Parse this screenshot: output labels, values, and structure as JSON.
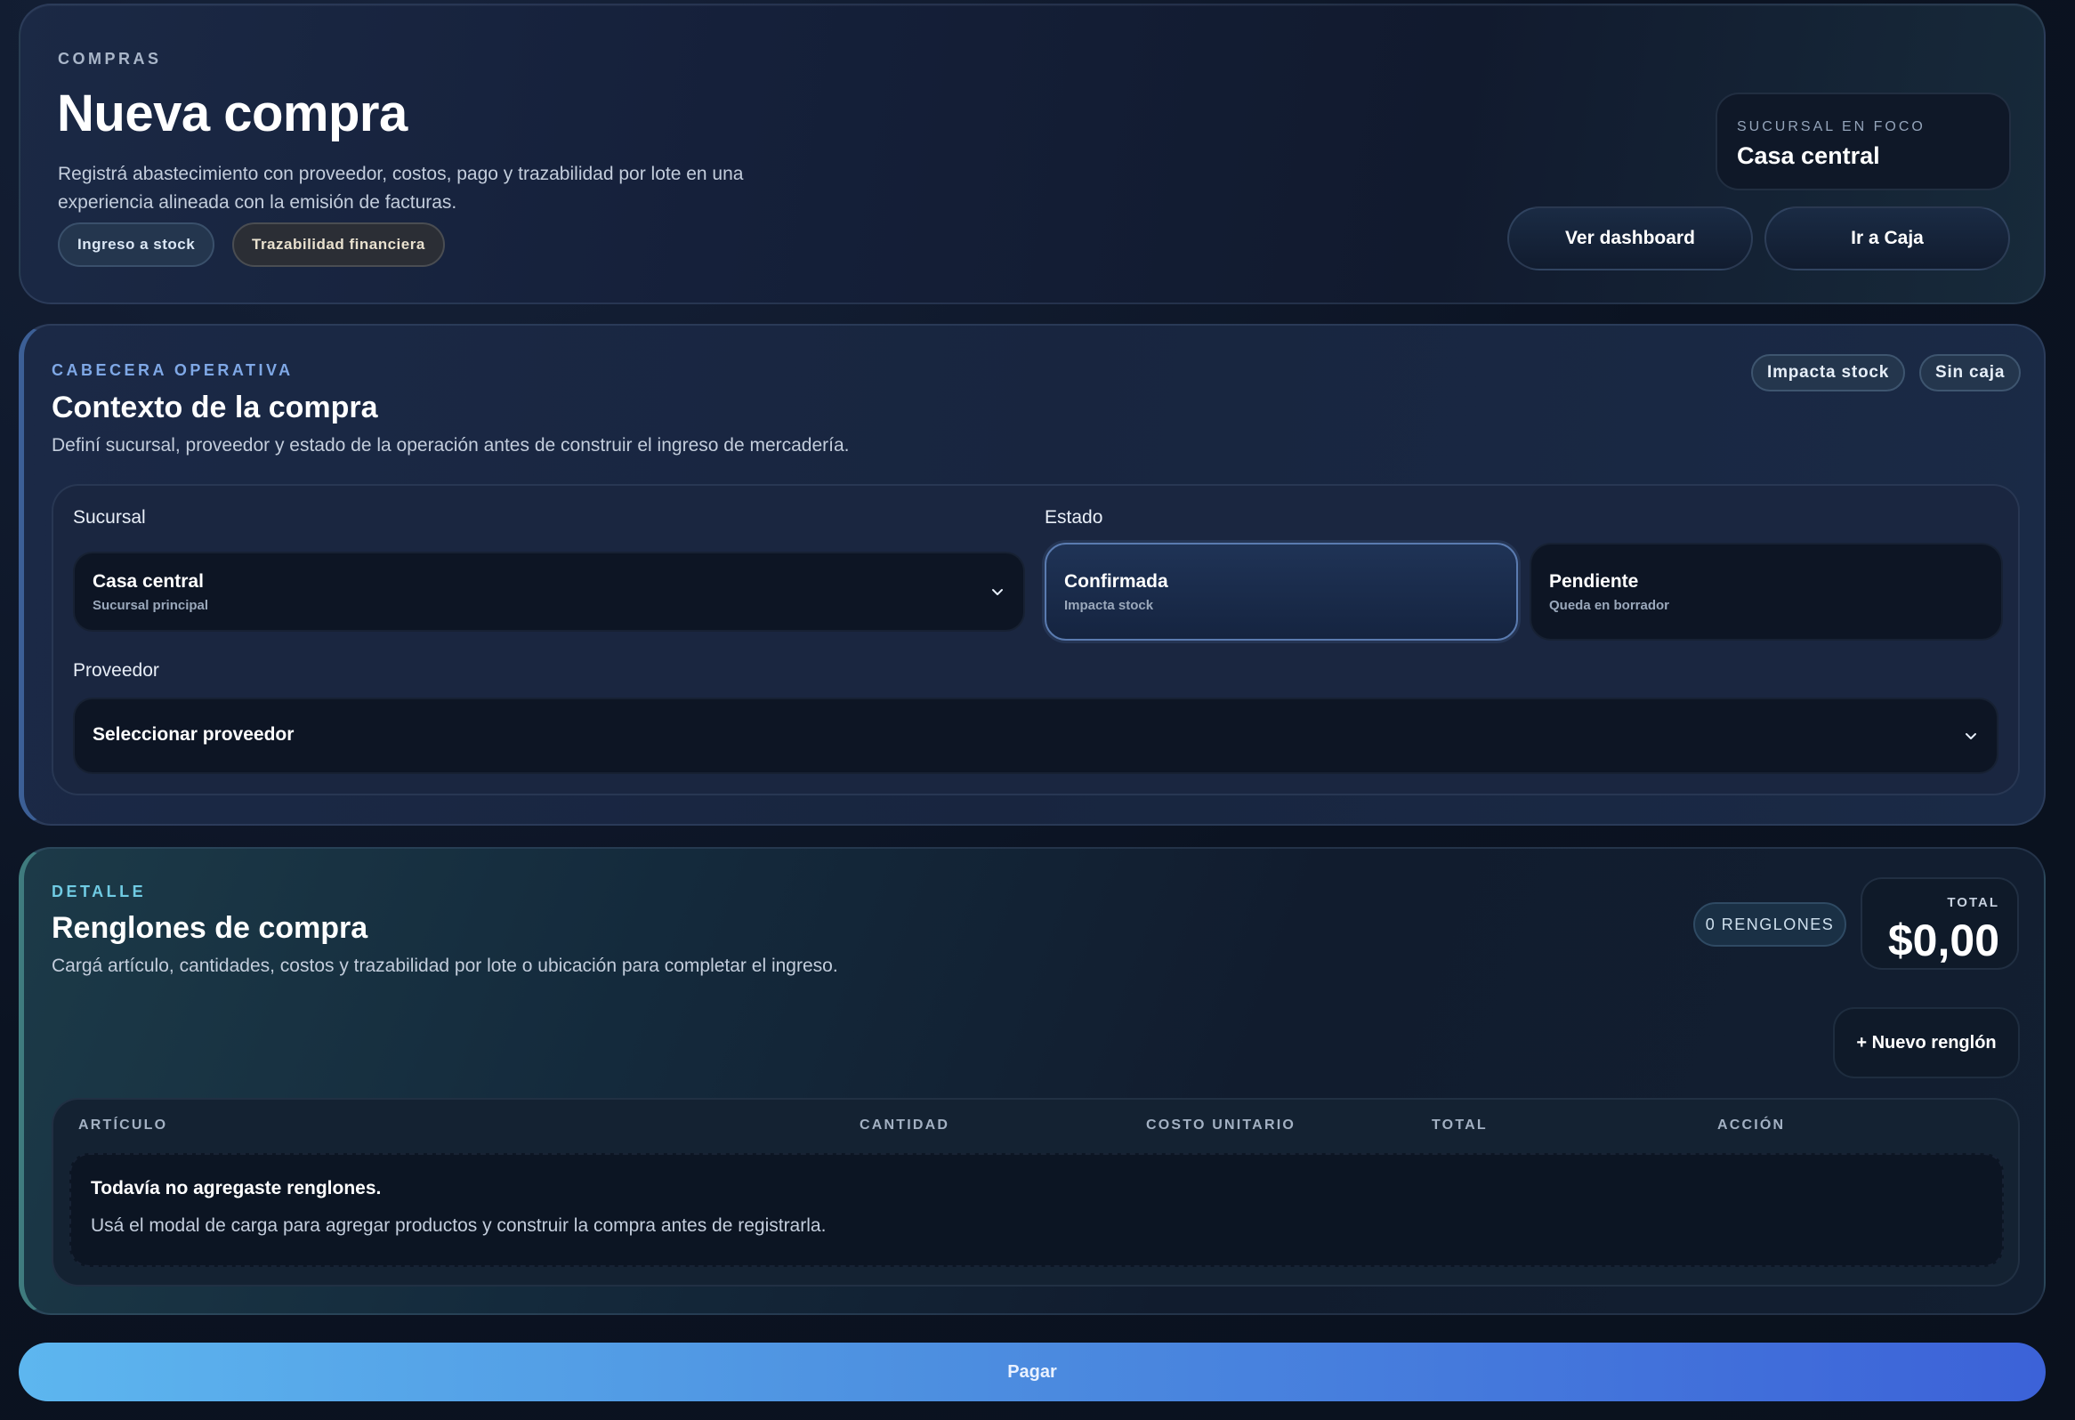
{
  "hero": {
    "eyebrow": "COMPRAS",
    "title": "Nueva compra",
    "description": "Registrá abastecimiento con proveedor, costos, pago y trazabilidad por lote en una experiencia alineada con la emisión de facturas.",
    "chips": [
      "Ingreso a stock",
      "Trazabilidad financiera"
    ],
    "focus_label": "SUCURSAL EN FOCO",
    "focus_value": "Casa central",
    "buttons": {
      "dashboard": "Ver dashboard",
      "caja": "Ir a Caja"
    }
  },
  "context": {
    "eyebrow": "CABECERA OPERATIVA",
    "title": "Contexto de la compra",
    "description": "Definí sucursal, proveedor y estado de la operación antes de construir el ingreso de mercadería.",
    "pills": [
      "Impacta stock",
      "Sin caja"
    ],
    "sucursal": {
      "label": "Sucursal",
      "value": "Casa central",
      "sub": "Sucursal principal"
    },
    "estado": {
      "label": "Estado",
      "options": [
        {
          "main": "Confirmada",
          "sub": "Impacta stock",
          "selected": true
        },
        {
          "main": "Pendiente",
          "sub": "Queda en borrador",
          "selected": false
        }
      ]
    },
    "proveedor": {
      "label": "Proveedor",
      "value": "Seleccionar proveedor"
    }
  },
  "detail": {
    "eyebrow": "DETALLE",
    "title": "Renglones de compra",
    "description": "Cargá artículo, cantidades, costos y trazabilidad por lote o ubicación para completar el ingreso.",
    "count": "0 RENGLONES",
    "total_label": "TOTAL",
    "total_value": "$0,00",
    "new_button": "+ Nuevo renglón",
    "columns": [
      "ARTÍCULO",
      "CANTIDAD",
      "COSTO UNITARIO",
      "TOTAL",
      "ACCIÓN"
    ],
    "empty_title": "Todavía no agregaste renglones.",
    "empty_text": "Usá el modal de carga para agregar productos y construir la compra antes de registrarla."
  },
  "pay_button": "Pagar",
  "colors": {
    "accent_blue": "#4d8fe0",
    "accent_teal": "#70cbe3",
    "background": "#0b1322"
  }
}
